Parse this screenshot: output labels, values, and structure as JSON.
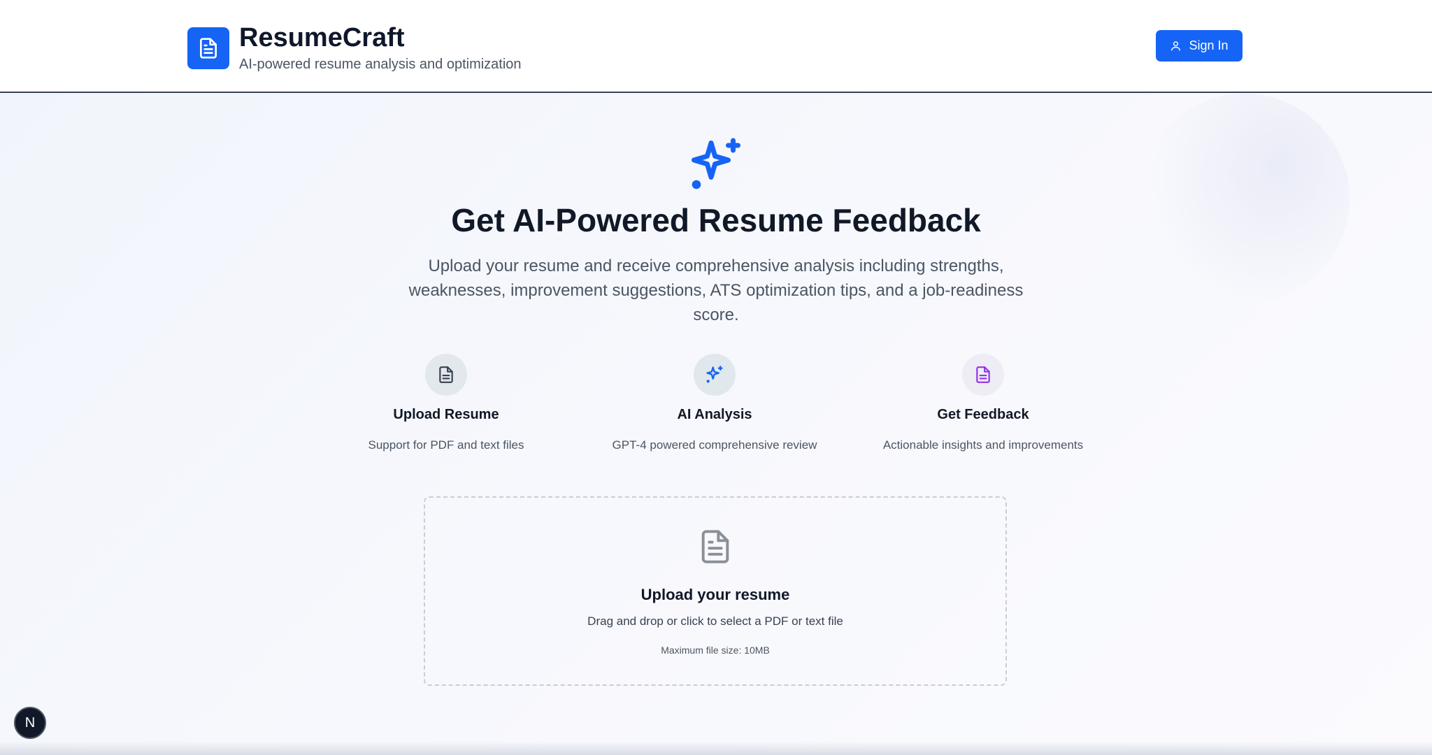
{
  "header": {
    "app_name": "ResumeCraft",
    "tagline": "AI-powered resume analysis and optimization",
    "sign_in_label": "Sign In",
    "logo_icon": "document-icon",
    "sign_in_icon": "user-icon"
  },
  "hero": {
    "icon": "sparkles-icon",
    "title": "Get AI-Powered Resume Feedback",
    "description": "Upload your resume and receive comprehensive analysis including strengths, weaknesses, improvement suggestions, ATS optimization tips, and a job-readiness score."
  },
  "features": [
    {
      "icon": "document-icon",
      "title": "Upload Resume",
      "description": "Support for PDF and text files",
      "color": "#374151"
    },
    {
      "icon": "sparkles-icon",
      "title": "AI Analysis",
      "description": "GPT-4 powered comprehensive review",
      "color": "#1664f5"
    },
    {
      "icon": "document-icon",
      "title": "Get Feedback",
      "description": "Actionable insights and improvements",
      "color": "#9333ea"
    }
  ],
  "upload": {
    "icon": "document-icon",
    "title": "Upload your resume",
    "description": "Drag and drop or click to select a PDF or text file",
    "note": "Maximum file size: 10MB"
  },
  "dev_badge": {
    "label": "N"
  },
  "colors": {
    "accent": "#1664f5",
    "heading": "#111827",
    "muted": "#4b5563"
  }
}
